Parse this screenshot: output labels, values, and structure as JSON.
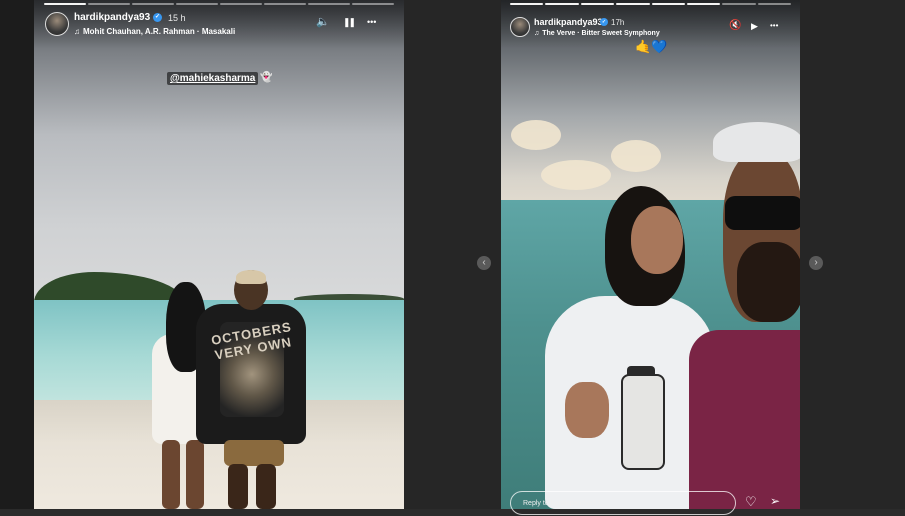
{
  "stories": [
    {
      "username": "hardikpandya93",
      "time": "15 h",
      "music": "Mohit Chauhan, A.R. Rahman · Masakali",
      "mention": "@mahiekasharma",
      "jacket_print": "OCTOBERS VERY OWN",
      "controls": {
        "sound_icon": "speaker-icon",
        "pause_icon": "pause-icon",
        "more_icon": "more-icon"
      }
    },
    {
      "username": "hardikpandya93",
      "time": "17h",
      "music": "The Verve · Bitter Sweet Symphony",
      "emojis": "🤙💙",
      "reply_placeholder": "Reply to hardikpandya93...",
      "controls": {
        "mute_icon": "muted-speaker-icon",
        "play_icon": "play-icon",
        "more_icon": "more-icon"
      }
    }
  ],
  "navigation": {
    "prev": "‹",
    "next": "›"
  },
  "glyphs": {
    "verified": "✓",
    "music_note": "♫",
    "sound": "🔈",
    "pause": "❚❚",
    "more": "•••",
    "mute": "🔇",
    "play": "▶",
    "heart": "♡",
    "send": "➢",
    "mention_emoji": "👻"
  },
  "colors": {
    "verified": "#3897f0",
    "background": "#2b2b2b"
  }
}
